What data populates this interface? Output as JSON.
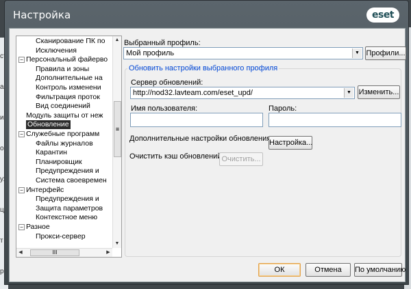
{
  "background": {
    "left_fragments": [
      "ст",
      "а",
      "и",
      "ом",
      "уж",
      "ц",
      "т",
      "ри"
    ]
  },
  "window": {
    "title": "Настройка",
    "logo": "eset"
  },
  "tree": {
    "items": [
      {
        "label": "Сканирование ПК по",
        "indent": 2
      },
      {
        "label": "Исключения",
        "indent": 2
      },
      {
        "label": "Персональный файерво",
        "indent": 1,
        "toggle": "−"
      },
      {
        "label": "Правила и зоны",
        "indent": 2
      },
      {
        "label": "Дополнительные на",
        "indent": 2
      },
      {
        "label": "Контроль изменени",
        "indent": 2
      },
      {
        "label": "Фильтрация проток",
        "indent": 2
      },
      {
        "label": "Вид соединений",
        "indent": 2
      },
      {
        "label": "Модуль защиты от неж",
        "indent": 1
      },
      {
        "label": "Обновление",
        "indent": 1,
        "selected": true
      },
      {
        "label": "Служебные программ",
        "indent": 1,
        "toggle": "−"
      },
      {
        "label": "Файлы журналов",
        "indent": 2
      },
      {
        "label": "Карантин",
        "indent": 2
      },
      {
        "label": "Планировщик",
        "indent": 2
      },
      {
        "label": "Предупреждения и",
        "indent": 2
      },
      {
        "label": "Система своевремен",
        "indent": 2
      },
      {
        "label": "Интерфейс",
        "indent": 1,
        "toggle": "−"
      },
      {
        "label": "Предупреждения и",
        "indent": 2
      },
      {
        "label": "Защита параметров",
        "indent": 2
      },
      {
        "label": "Контекстное меню",
        "indent": 2
      },
      {
        "label": "Разное",
        "indent": 1,
        "toggle": "−"
      },
      {
        "label": "Прокси-сервер",
        "indent": 2
      }
    ],
    "hscroll_thumb": "III",
    "vscroll_thumb": "≡"
  },
  "profile": {
    "label": "Выбранный профиль:",
    "value": "Мой профиль",
    "button": "Профили..."
  },
  "group": {
    "title": "Обновить настройки выбранного профиля",
    "server_label": "Сервер обновлений:",
    "server_value": "http://nod32.lavteam.com/eset_upd/",
    "change_button": "Изменить...",
    "username_label": "Имя пользователя:",
    "username_value": "",
    "password_label": "Пароль:",
    "password_value": "",
    "advanced_label": "Дополнительные настройки обновления:",
    "advanced_button": "Настройка...",
    "cache_label": "Очистить кэш обновлений:",
    "cache_button": "Очистить..."
  },
  "footer": {
    "ok": "ОК",
    "cancel": "Отмена",
    "default": "По умолчанию"
  }
}
